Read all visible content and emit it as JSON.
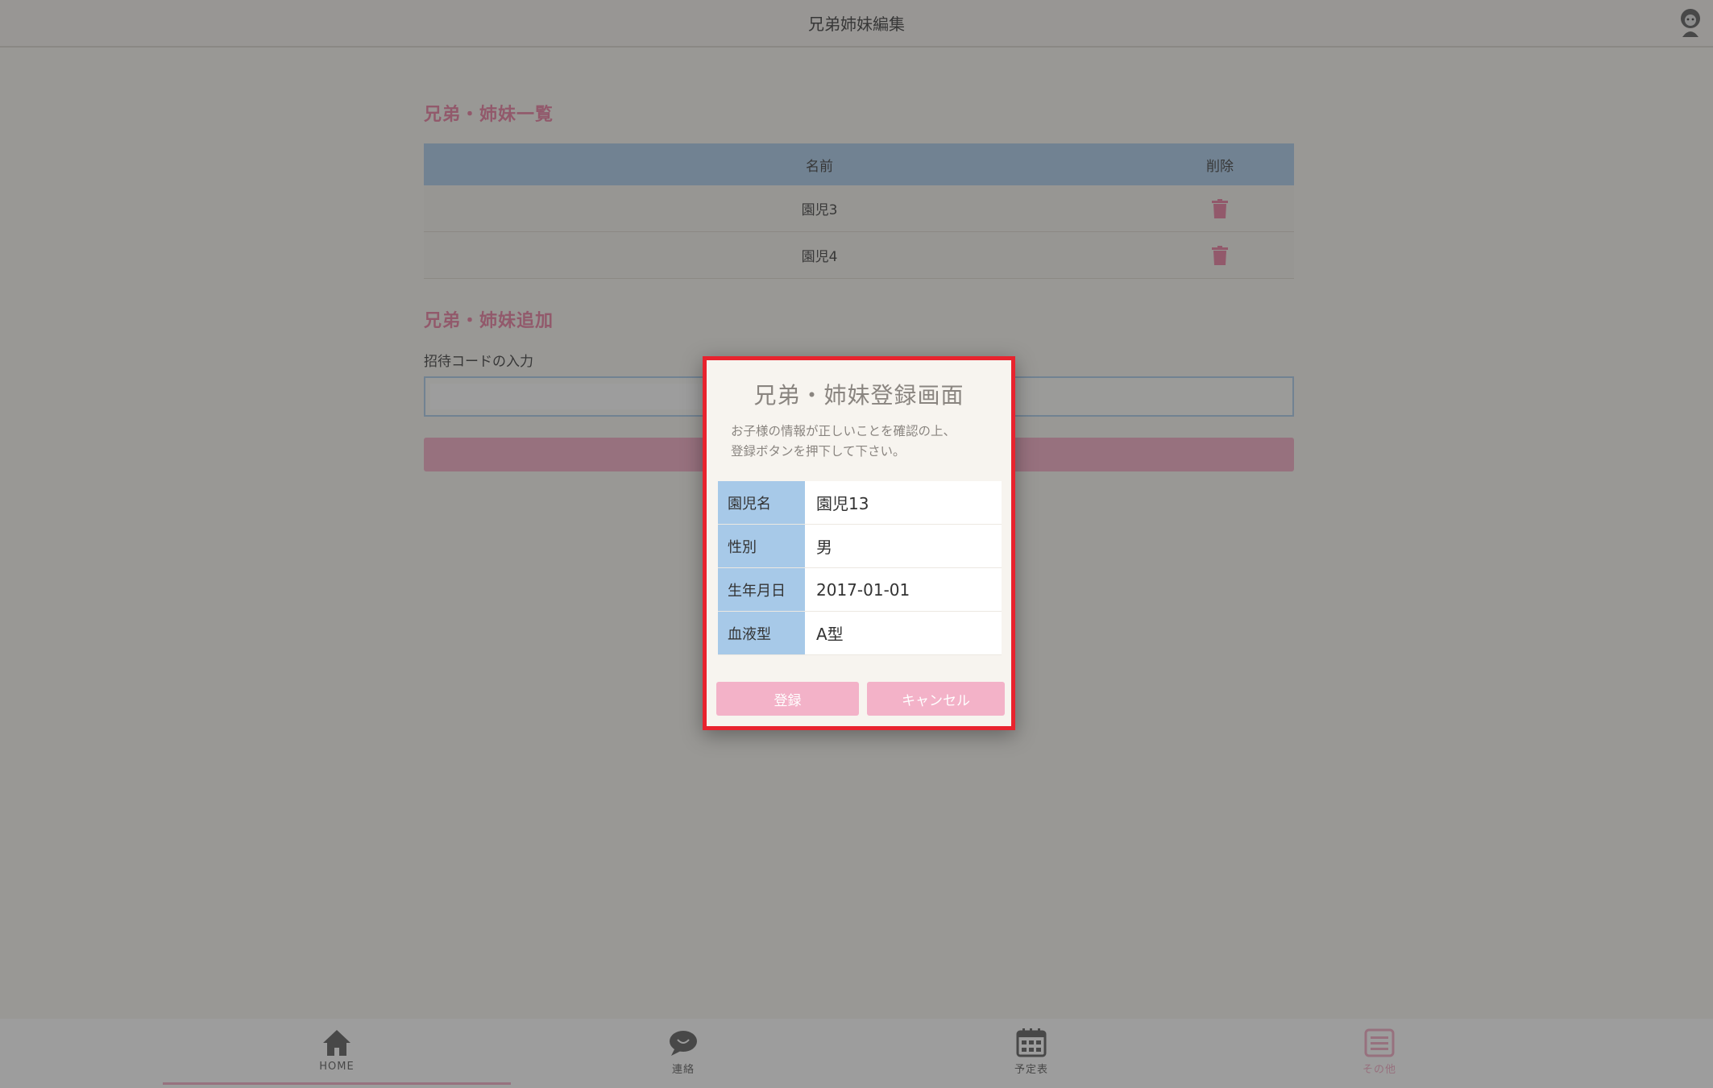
{
  "header": {
    "title": "兄弟姉妹編集",
    "avatar_icon": "user-avatar-icon"
  },
  "siblings": {
    "list_title": "兄弟・姉妹一覧",
    "columns": {
      "name": "名前",
      "delete": "削除"
    },
    "rows": [
      {
        "name": "園児3"
      },
      {
        "name": "園児4"
      }
    ]
  },
  "add": {
    "title": "兄弟・姉妹追加",
    "invite_label": "招待コードの入力"
  },
  "modal": {
    "title": "兄弟・姉妹登録画面",
    "description_line1": "お子様の情報が正しいことを確認の上、",
    "description_line2": "登録ボタンを押下して下さい。",
    "fields": [
      {
        "key": "園児名",
        "value": "園児13"
      },
      {
        "key": "性別",
        "value": "男"
      },
      {
        "key": "生年月日",
        "value": "2017-01-01"
      },
      {
        "key": "血液型",
        "value": "A型"
      }
    ],
    "register_label": "登録",
    "cancel_label": "キャンセル"
  },
  "tabs": [
    {
      "label": "HOME",
      "icon": "home-icon"
    },
    {
      "label": "連絡",
      "icon": "chat-icon"
    },
    {
      "label": "予定表",
      "icon": "calendar-icon"
    },
    {
      "label": "その他",
      "icon": "menu-icon"
    }
  ],
  "colors": {
    "accent_pink": "#e8779b",
    "header_blue": "#a7c9e8",
    "modal_border": "#e8232e",
    "button_pink": "#f3b2c8"
  }
}
